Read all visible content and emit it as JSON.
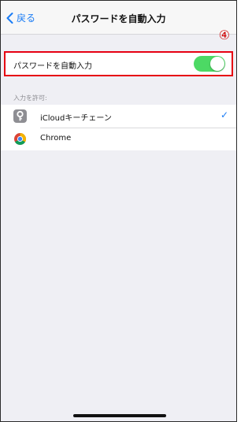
{
  "navbar": {
    "back_label": "戻る",
    "title": "パスワードを自動入力"
  },
  "annotation": {
    "step_marker": "④",
    "highlight_color": "#e60012"
  },
  "autofill": {
    "label": "パスワードを自動入力",
    "enabled": true,
    "switch_color": "#4cd964"
  },
  "allow_section": {
    "header": "入力を許可:",
    "items": [
      {
        "label": "iCloudキーチェーン",
        "icon": "keychain-icon",
        "selected": true,
        "check": "✓"
      },
      {
        "label": "Chrome",
        "icon": "chrome-icon",
        "selected": false
      }
    ]
  },
  "colors": {
    "accent": "#1a7cf5",
    "background": "#efeff4"
  }
}
